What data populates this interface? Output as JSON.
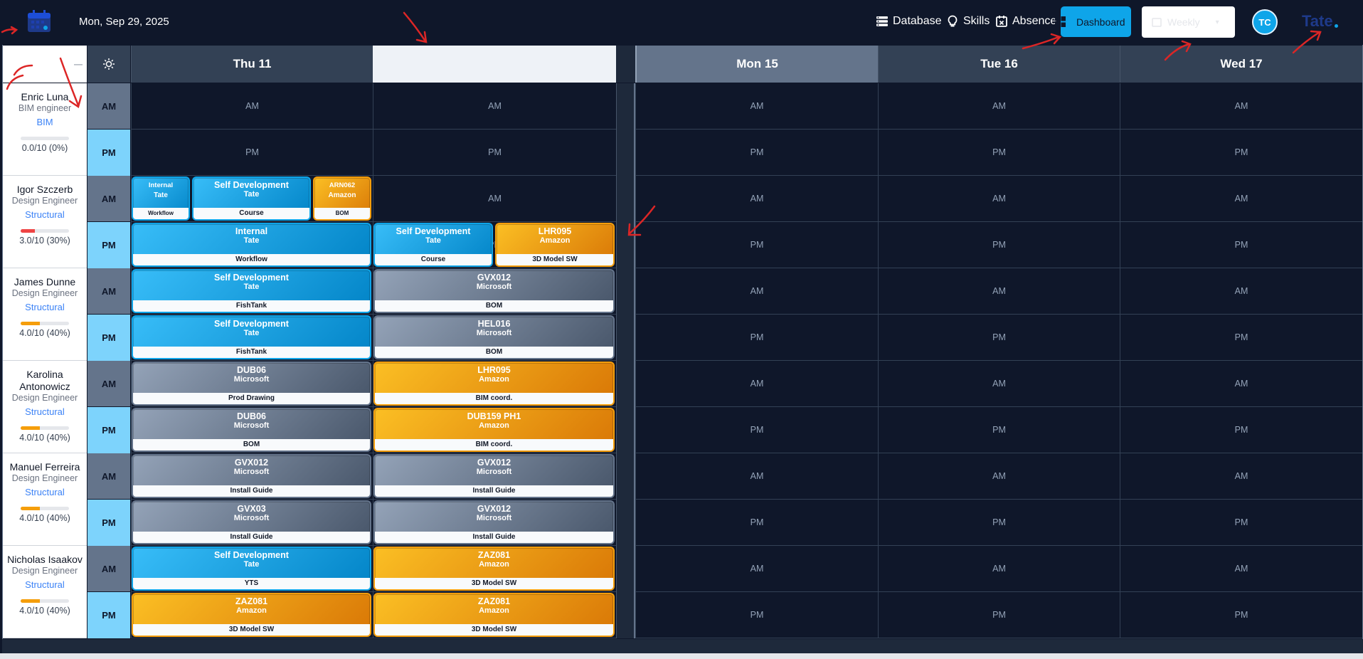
{
  "header": {
    "date": "Mon, Sep 29, 2025",
    "nav": {
      "database": "Database",
      "skills": "Skills",
      "absence": "Absence",
      "dashboard": "Dashboard"
    },
    "view_select": "Weekly",
    "avatar_initials": "TC",
    "brand": "Tate"
  },
  "days": [
    "Thu 11",
    "",
    "Mon 15",
    "Tue 16",
    "Wed 17"
  ],
  "half_labels": {
    "am": "AM",
    "pm": "PM"
  },
  "people": [
    {
      "name": "Enric Luna",
      "role": "BIM engineer",
      "dept": "BIM",
      "score": "0.0/10 (0%)",
      "load": 0,
      "bar_color": "#ef4444"
    },
    {
      "name": "Igor Szczerb",
      "role": "Design Engineer",
      "dept": "Structural",
      "score": "3.0/10 (30%)",
      "load": 0.3,
      "bar_color": "#ef4444"
    },
    {
      "name": "James Dunne",
      "role": "Design Engineer",
      "dept": "Structural",
      "score": "4.0/10 (40%)",
      "load": 0.4,
      "bar_color": "#f59e0b"
    },
    {
      "name": "Karolina Antonowicz",
      "role": "Design Engineer",
      "dept": "Structural",
      "score": "4.0/10 (40%)",
      "load": 0.4,
      "bar_color": "#f59e0b"
    },
    {
      "name": "Manuel Ferreira",
      "role": "Design Engineer",
      "dept": "Structural",
      "score": "4.0/10 (40%)",
      "load": 0.4,
      "bar_color": "#f59e0b"
    },
    {
      "name": "Nicholas Isaakov",
      "role": "Design Engineer",
      "dept": "Structural",
      "score": "4.0/10 (40%)",
      "load": 0.4,
      "bar_color": "#f59e0b"
    }
  ],
  "cards": [
    {
      "row": 1,
      "half": "am",
      "col": 0,
      "span": 0.25,
      "offset": 0,
      "color": "blue",
      "small": true,
      "code": "Internal",
      "client": "Tate",
      "task": "Workflow"
    },
    {
      "row": 1,
      "half": "am",
      "col": 0,
      "span": 0.5,
      "offset": 0.25,
      "color": "blue",
      "small": false,
      "code": "Self Development",
      "client": "Tate",
      "task": "Course"
    },
    {
      "row": 1,
      "half": "am",
      "col": 0,
      "span": 0.25,
      "offset": 0.75,
      "color": "orange",
      "small": true,
      "code": "ARN062",
      "client": "Amazon",
      "task": "BOM"
    },
    {
      "row": 1,
      "half": "pm",
      "col": 0,
      "span": 1,
      "offset": 0,
      "color": "blue",
      "small": false,
      "code": "Internal",
      "client": "Tate",
      "task": "Workflow"
    },
    {
      "row": 1,
      "half": "pm",
      "col": 1,
      "span": 0.5,
      "offset": 0,
      "color": "blue",
      "small": false,
      "code": "Self Development",
      "client": "Tate",
      "task": "Course"
    },
    {
      "row": 1,
      "half": "pm",
      "col": 1,
      "span": 0.5,
      "offset": 0.5,
      "color": "orange",
      "small": false,
      "code": "LHR095",
      "client": "Amazon",
      "task": "3D Model SW"
    },
    {
      "row": 2,
      "half": "am",
      "col": 0,
      "span": 1,
      "offset": 0,
      "color": "blue",
      "small": false,
      "code": "Self Development",
      "client": "Tate",
      "task": "FishTank"
    },
    {
      "row": 2,
      "half": "am",
      "col": 1,
      "span": 1,
      "offset": 0,
      "color": "gray",
      "small": false,
      "code": "GVX012",
      "client": "Microsoft",
      "task": "BOM"
    },
    {
      "row": 2,
      "half": "pm",
      "col": 0,
      "span": 1,
      "offset": 0,
      "color": "blue",
      "small": false,
      "code": "Self Development",
      "client": "Tate",
      "task": "FishTank"
    },
    {
      "row": 2,
      "half": "pm",
      "col": 1,
      "span": 1,
      "offset": 0,
      "color": "gray",
      "small": false,
      "code": "HEL016",
      "client": "Microsoft",
      "task": "BOM"
    },
    {
      "row": 3,
      "half": "am",
      "col": 0,
      "span": 1,
      "offset": 0,
      "color": "gray",
      "small": false,
      "code": "DUB06",
      "client": "Microsoft",
      "task": "Prod Drawing"
    },
    {
      "row": 3,
      "half": "am",
      "col": 1,
      "span": 1,
      "offset": 0,
      "color": "orange",
      "small": false,
      "code": "LHR095",
      "client": "Amazon",
      "task": "BIM coord."
    },
    {
      "row": 3,
      "half": "pm",
      "col": 0,
      "span": 1,
      "offset": 0,
      "color": "gray",
      "small": false,
      "code": "DUB06",
      "client": "Microsoft",
      "task": "BOM"
    },
    {
      "row": 3,
      "half": "pm",
      "col": 1,
      "span": 1,
      "offset": 0,
      "color": "orange",
      "small": false,
      "code": "DUB159 PH1",
      "client": "Amazon",
      "task": "BIM coord."
    },
    {
      "row": 4,
      "half": "am",
      "col": 0,
      "span": 1,
      "offset": 0,
      "color": "gray",
      "small": false,
      "code": "GVX012",
      "client": "Microsoft",
      "task": "Install Guide"
    },
    {
      "row": 4,
      "half": "am",
      "col": 1,
      "span": 1,
      "offset": 0,
      "color": "gray",
      "small": false,
      "code": "GVX012",
      "client": "Microsoft",
      "task": "Install Guide"
    },
    {
      "row": 4,
      "half": "pm",
      "col": 0,
      "span": 1,
      "offset": 0,
      "color": "gray",
      "small": false,
      "code": "GVX03",
      "client": "Microsoft",
      "task": "Install Guide"
    },
    {
      "row": 4,
      "half": "pm",
      "col": 1,
      "span": 1,
      "offset": 0,
      "color": "gray",
      "small": false,
      "code": "GVX012",
      "client": "Microsoft",
      "task": "Install Guide"
    },
    {
      "row": 5,
      "half": "am",
      "col": 0,
      "span": 1,
      "offset": 0,
      "color": "blue",
      "small": false,
      "code": "Self Development",
      "client": "Tate",
      "task": "YTS"
    },
    {
      "row": 5,
      "half": "am",
      "col": 1,
      "span": 1,
      "offset": 0,
      "color": "orange",
      "small": false,
      "code": "ZAZ081",
      "client": "Amazon",
      "task": "3D Model SW"
    },
    {
      "row": 5,
      "half": "pm",
      "col": 0,
      "span": 1,
      "offset": 0,
      "color": "orange",
      "small": false,
      "code": "ZAZ081",
      "client": "Amazon",
      "task": "3D Model SW"
    },
    {
      "row": 5,
      "half": "pm",
      "col": 1,
      "span": 1,
      "offset": 0,
      "color": "orange",
      "small": false,
      "code": "ZAZ081",
      "client": "Amazon",
      "task": "3D Model SW"
    }
  ],
  "colors": {
    "accent": "#0ea5e9",
    "annotation": "#dc2626"
  }
}
